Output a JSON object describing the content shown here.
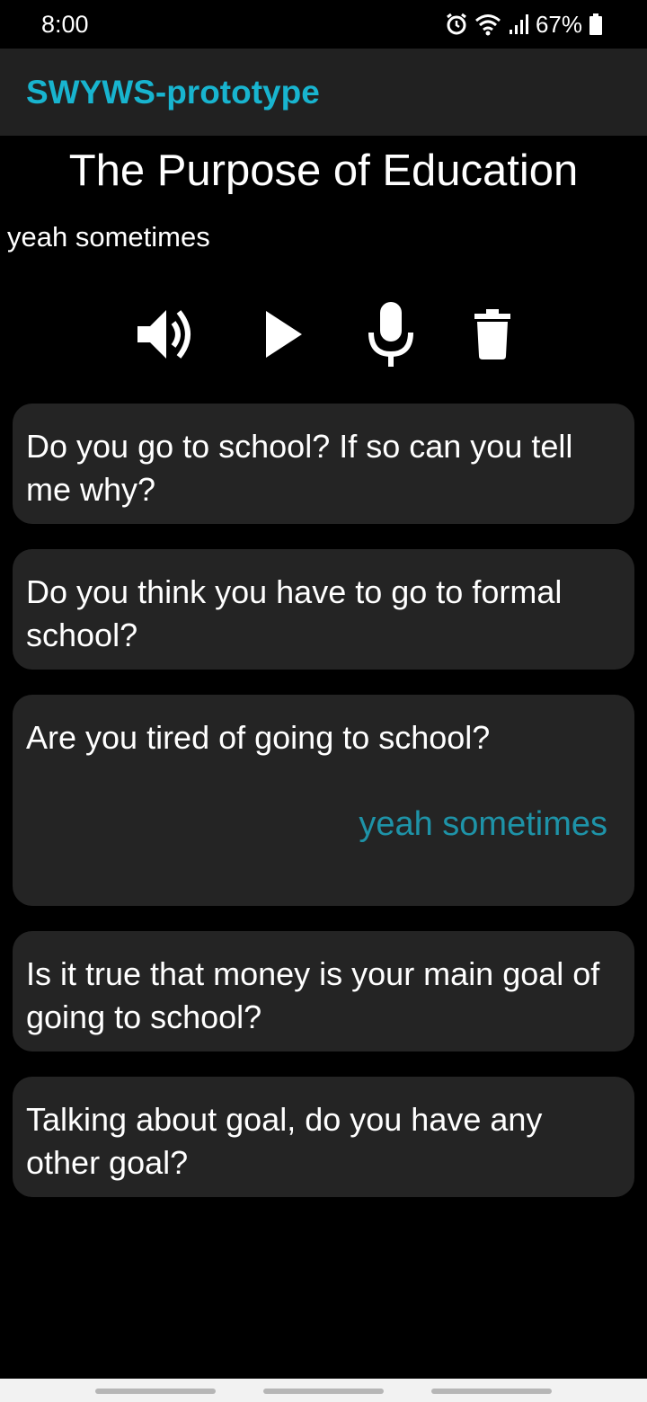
{
  "status": {
    "time": "8:00",
    "battery_percent": "67%",
    "icons": [
      "alarm-icon",
      "wifi-icon",
      "signal-icon",
      "battery-icon"
    ]
  },
  "app_bar": {
    "title": "SWYWS-prototype",
    "accent_color": "#18b4cf"
  },
  "topic": {
    "title": "The Purpose of Education",
    "transcript": "yeah sometimes"
  },
  "controls": [
    {
      "name": "speaker",
      "icon": "volume-icon"
    },
    {
      "name": "play",
      "icon": "play-icon"
    },
    {
      "name": "record",
      "icon": "mic-icon"
    },
    {
      "name": "delete",
      "icon": "trash-icon"
    }
  ],
  "questions": [
    {
      "text": "Do you go to school? If so can you tell me why?",
      "answer": ""
    },
    {
      "text": "Do you think you have to go to formal school?",
      "answer": ""
    },
    {
      "text": "Are you tired of going to school?",
      "answer": "yeah sometimes"
    },
    {
      "text": "Is it true that money is your main goal of going to school?",
      "answer": ""
    },
    {
      "text": "Talking about goal, do you have any other goal?",
      "answer": ""
    }
  ],
  "colors": {
    "background": "#000000",
    "card": "#242424",
    "answer_text": "#1e93a8"
  }
}
